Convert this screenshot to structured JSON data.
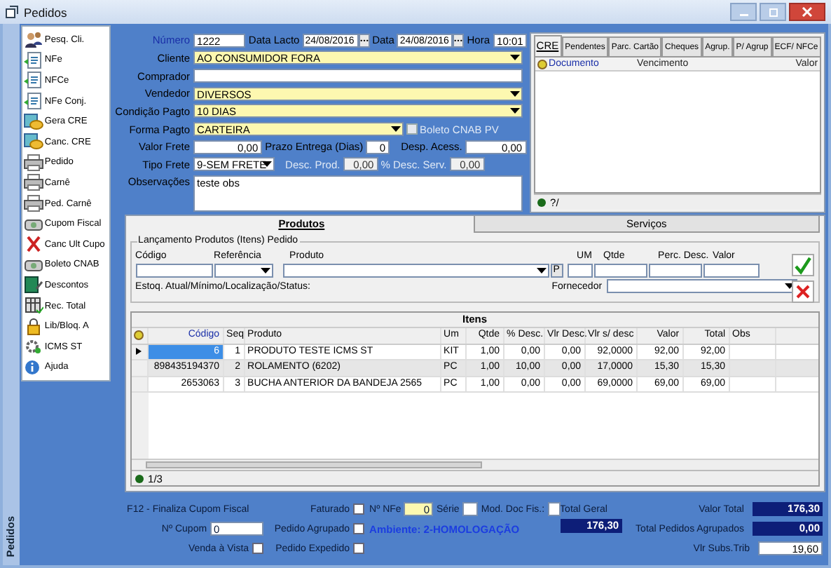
{
  "window": {
    "title": "Pedidos",
    "side_label": "Pedidos"
  },
  "sidebar": {
    "items": [
      {
        "label": "Pesq. Cli."
      },
      {
        "label": "NFe"
      },
      {
        "label": "NFCe"
      },
      {
        "label": "NFe Conj."
      },
      {
        "label": "Gera CRE"
      },
      {
        "label": "Canc. CRE"
      },
      {
        "label": "Pedido"
      },
      {
        "label": "Carnê"
      },
      {
        "label": "Ped. Carnê"
      },
      {
        "label": "Cupom Fiscal"
      },
      {
        "label": "Canc Ult Cupo"
      },
      {
        "label": "Boleto CNAB"
      },
      {
        "label": "Descontos"
      },
      {
        "label": "Rec. Total"
      },
      {
        "label": "Lib/Bloq. A"
      },
      {
        "label": "ICMS ST"
      },
      {
        "label": "Ajuda"
      }
    ]
  },
  "header": {
    "numero": {
      "label": "Número",
      "value": "1222"
    },
    "data_lacto": {
      "label": "Data Lacto",
      "value": "24/08/2016"
    },
    "data": {
      "label": "Data",
      "value": "24/08/2016"
    },
    "hora": {
      "label": "Hora",
      "value": "10:01"
    }
  },
  "form": {
    "cliente": {
      "label": "Cliente",
      "value": "AO CONSUMIDOR FORA",
      "highlighted": true
    },
    "comprador": {
      "label": "Comprador",
      "highlighted": false
    },
    "vendedor": {
      "label": "Vendedor",
      "value": "DIVERSOS",
      "highlighted": true
    },
    "condicao_pagto": {
      "label": "Condição Pagto",
      "value": "10 DIAS",
      "highlighted": true
    },
    "forma_pagto": {
      "label": "Forma Pagto",
      "value": "CARTEIRA",
      "highlighted": true
    },
    "boleto_cnab": {
      "label": "Boleto CNAB PV",
      "checked": false,
      "disabled": true
    },
    "valor_frete": {
      "label": "Valor Frete",
      "value": "0,00"
    },
    "prazo_entrega": {
      "label": "Prazo Entrega (Dias)",
      "value": "0"
    },
    "desp_acess": {
      "label": "Desp. Acess.",
      "value": "0,00"
    },
    "tipo_frete": {
      "label": "Tipo Frete",
      "value": "9-SEM FRETE"
    },
    "desc_prod": {
      "label": "Desc. Prod.",
      "value": "0,00",
      "disabled": true
    },
    "desc_serv": {
      "label": "% Desc. Serv.",
      "value": "0,00",
      "disabled": true
    },
    "observacoes": {
      "label": "Observações",
      "value": "teste obs"
    }
  },
  "side_panel": {
    "tabs": [
      {
        "label": "CRE",
        "selected": true
      },
      {
        "label": "Pendentes",
        "selected": false
      },
      {
        "label": "Parc. Cartão",
        "selected": false
      },
      {
        "label": "Cheques",
        "selected": false
      },
      {
        "label": "Agrup.",
        "selected": false
      },
      {
        "label": "P/ Agrup",
        "selected": false
      },
      {
        "label": "ECF/ NFCe",
        "selected": false
      }
    ],
    "columns": [
      "Documento",
      "Vencimento",
      "Valor"
    ],
    "footer": "?/"
  },
  "product_tabs": [
    {
      "label": "Produtos",
      "selected": true
    },
    {
      "label": "Serviços",
      "selected": false
    }
  ],
  "entry": {
    "legend": "Lançamento Produtos (Itens) Pedido",
    "columns": [
      "Código",
      "Referência",
      "Produto",
      "UM",
      "Qtde",
      "Perc. Desc.",
      "Valor"
    ],
    "p_button": "P",
    "stock_label": "Estoq. Atual/Mínimo/Localização/Status:",
    "supplier_label": "Fornecedor"
  },
  "items": {
    "caption": "Itens",
    "columns": [
      "Código",
      "Seq",
      "Produto",
      "Um",
      "Qtde",
      "% Desc.",
      "Vlr Desc.",
      "Vlr s/ desc",
      "Valor",
      "Total",
      "Obs"
    ],
    "rows": [
      {
        "selected": true,
        "cells": [
          "6",
          "1",
          "PRODUTO TESTE ICMS ST",
          "KIT",
          "1,00",
          "0,00",
          "0,00",
          "92,0000",
          "92,00",
          "92,00",
          ""
        ]
      },
      {
        "selected": false,
        "cells": [
          "898435194370",
          "2",
          "ROLAMENTO (6202)",
          "PC",
          "1,00",
          "10,00",
          "0,00",
          "17,0000",
          "15,30",
          "15,30",
          ""
        ]
      },
      {
        "selected": false,
        "cells": [
          "2653063",
          "3",
          "BUCHA ANTERIOR DA BANDEJA 2565",
          "PC",
          "1,00",
          "0,00",
          "0,00",
          "69,0000",
          "69,00",
          "69,00",
          ""
        ]
      }
    ],
    "footer": "1/3"
  },
  "footer": {
    "hint": "F12 - Finaliza Cupom Fiscal",
    "faturado": {
      "label": "Faturado",
      "checked": false
    },
    "nfe": {
      "label": "Nº NFe",
      "value": "0"
    },
    "serie": {
      "label": "Série"
    },
    "mod_doc": {
      "label": "Mod. Doc Fis.:"
    },
    "cupom": {
      "label": "Nº Cupom",
      "value": "0"
    },
    "pedido_agrupado": {
      "label": "Pedido Agrupado",
      "checked": false
    },
    "ambiente": "Ambiente: 2-HOMOLOGAÇÃO",
    "venda_vista": {
      "label": "Venda à Vista",
      "checked": false
    },
    "pedido_expedido": {
      "label": "Pedido Expedido",
      "checked": false
    },
    "total_geral": {
      "label": "Total Geral",
      "value": "176,30"
    },
    "valor_total": {
      "label": "Valor Total",
      "value": "176,30"
    },
    "total_agrupados": {
      "label": "Total Pedidos Agrupados",
      "value": "0,00"
    },
    "subs_trib": {
      "label": "Vlr Subs.Trib",
      "value": "19,60"
    }
  }
}
